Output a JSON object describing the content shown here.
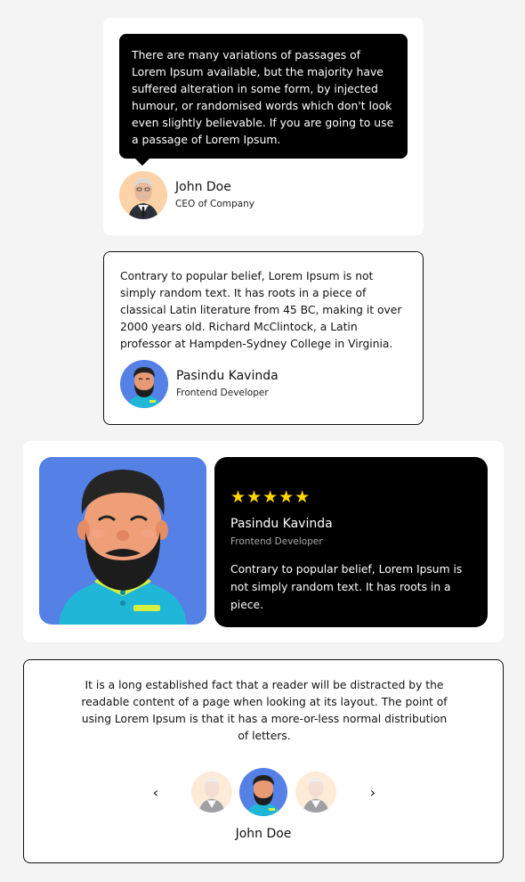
{
  "card1": {
    "quote": "There are many variations of passages of Lorem Ipsum available, but the majority have suffered alteration in some form, by injected humour, or randomised words which don't look even slightly believable. If you are going to use a passage of Lorem Ipsum.",
    "name": "John Doe",
    "role": "CEO of Company"
  },
  "card2": {
    "quote": "Contrary to popular belief, Lorem Ipsum is not simply random text. It has roots in a piece of classical Latin literature from 45 BC, making it over 2000 years old. Richard McClintock, a Latin professor at Hampden-Sydney College in Virginia.",
    "name": "Pasindu Kavinda",
    "role": "Frontend Developer"
  },
  "card3": {
    "stars": "★★★★★",
    "rating": 5,
    "name": "Pasindu Kavinda",
    "role": "Frontend Developer",
    "quote": "Contrary to popular belief, Lorem Ipsum is not simply random text. It has roots in a piece."
  },
  "card4": {
    "quote": "It is a long established fact that a reader will be distracted by the readable content of a page when looking at its layout. The point of using Lorem Ipsum is that it has a more-or-less normal distribution of letters.",
    "prev": "‹",
    "next": "›",
    "name": "John Doe"
  },
  "colors": {
    "background": "#f4f4f4",
    "card": "#ffffff",
    "dark": "#000000",
    "avatar_blue": "#5580e6",
    "avatar_peach": "#fcd3a8",
    "star": "#ffd400"
  },
  "icons": {
    "prev": "chevron-left-icon",
    "next": "chevron-right-icon",
    "star": "star-icon"
  }
}
